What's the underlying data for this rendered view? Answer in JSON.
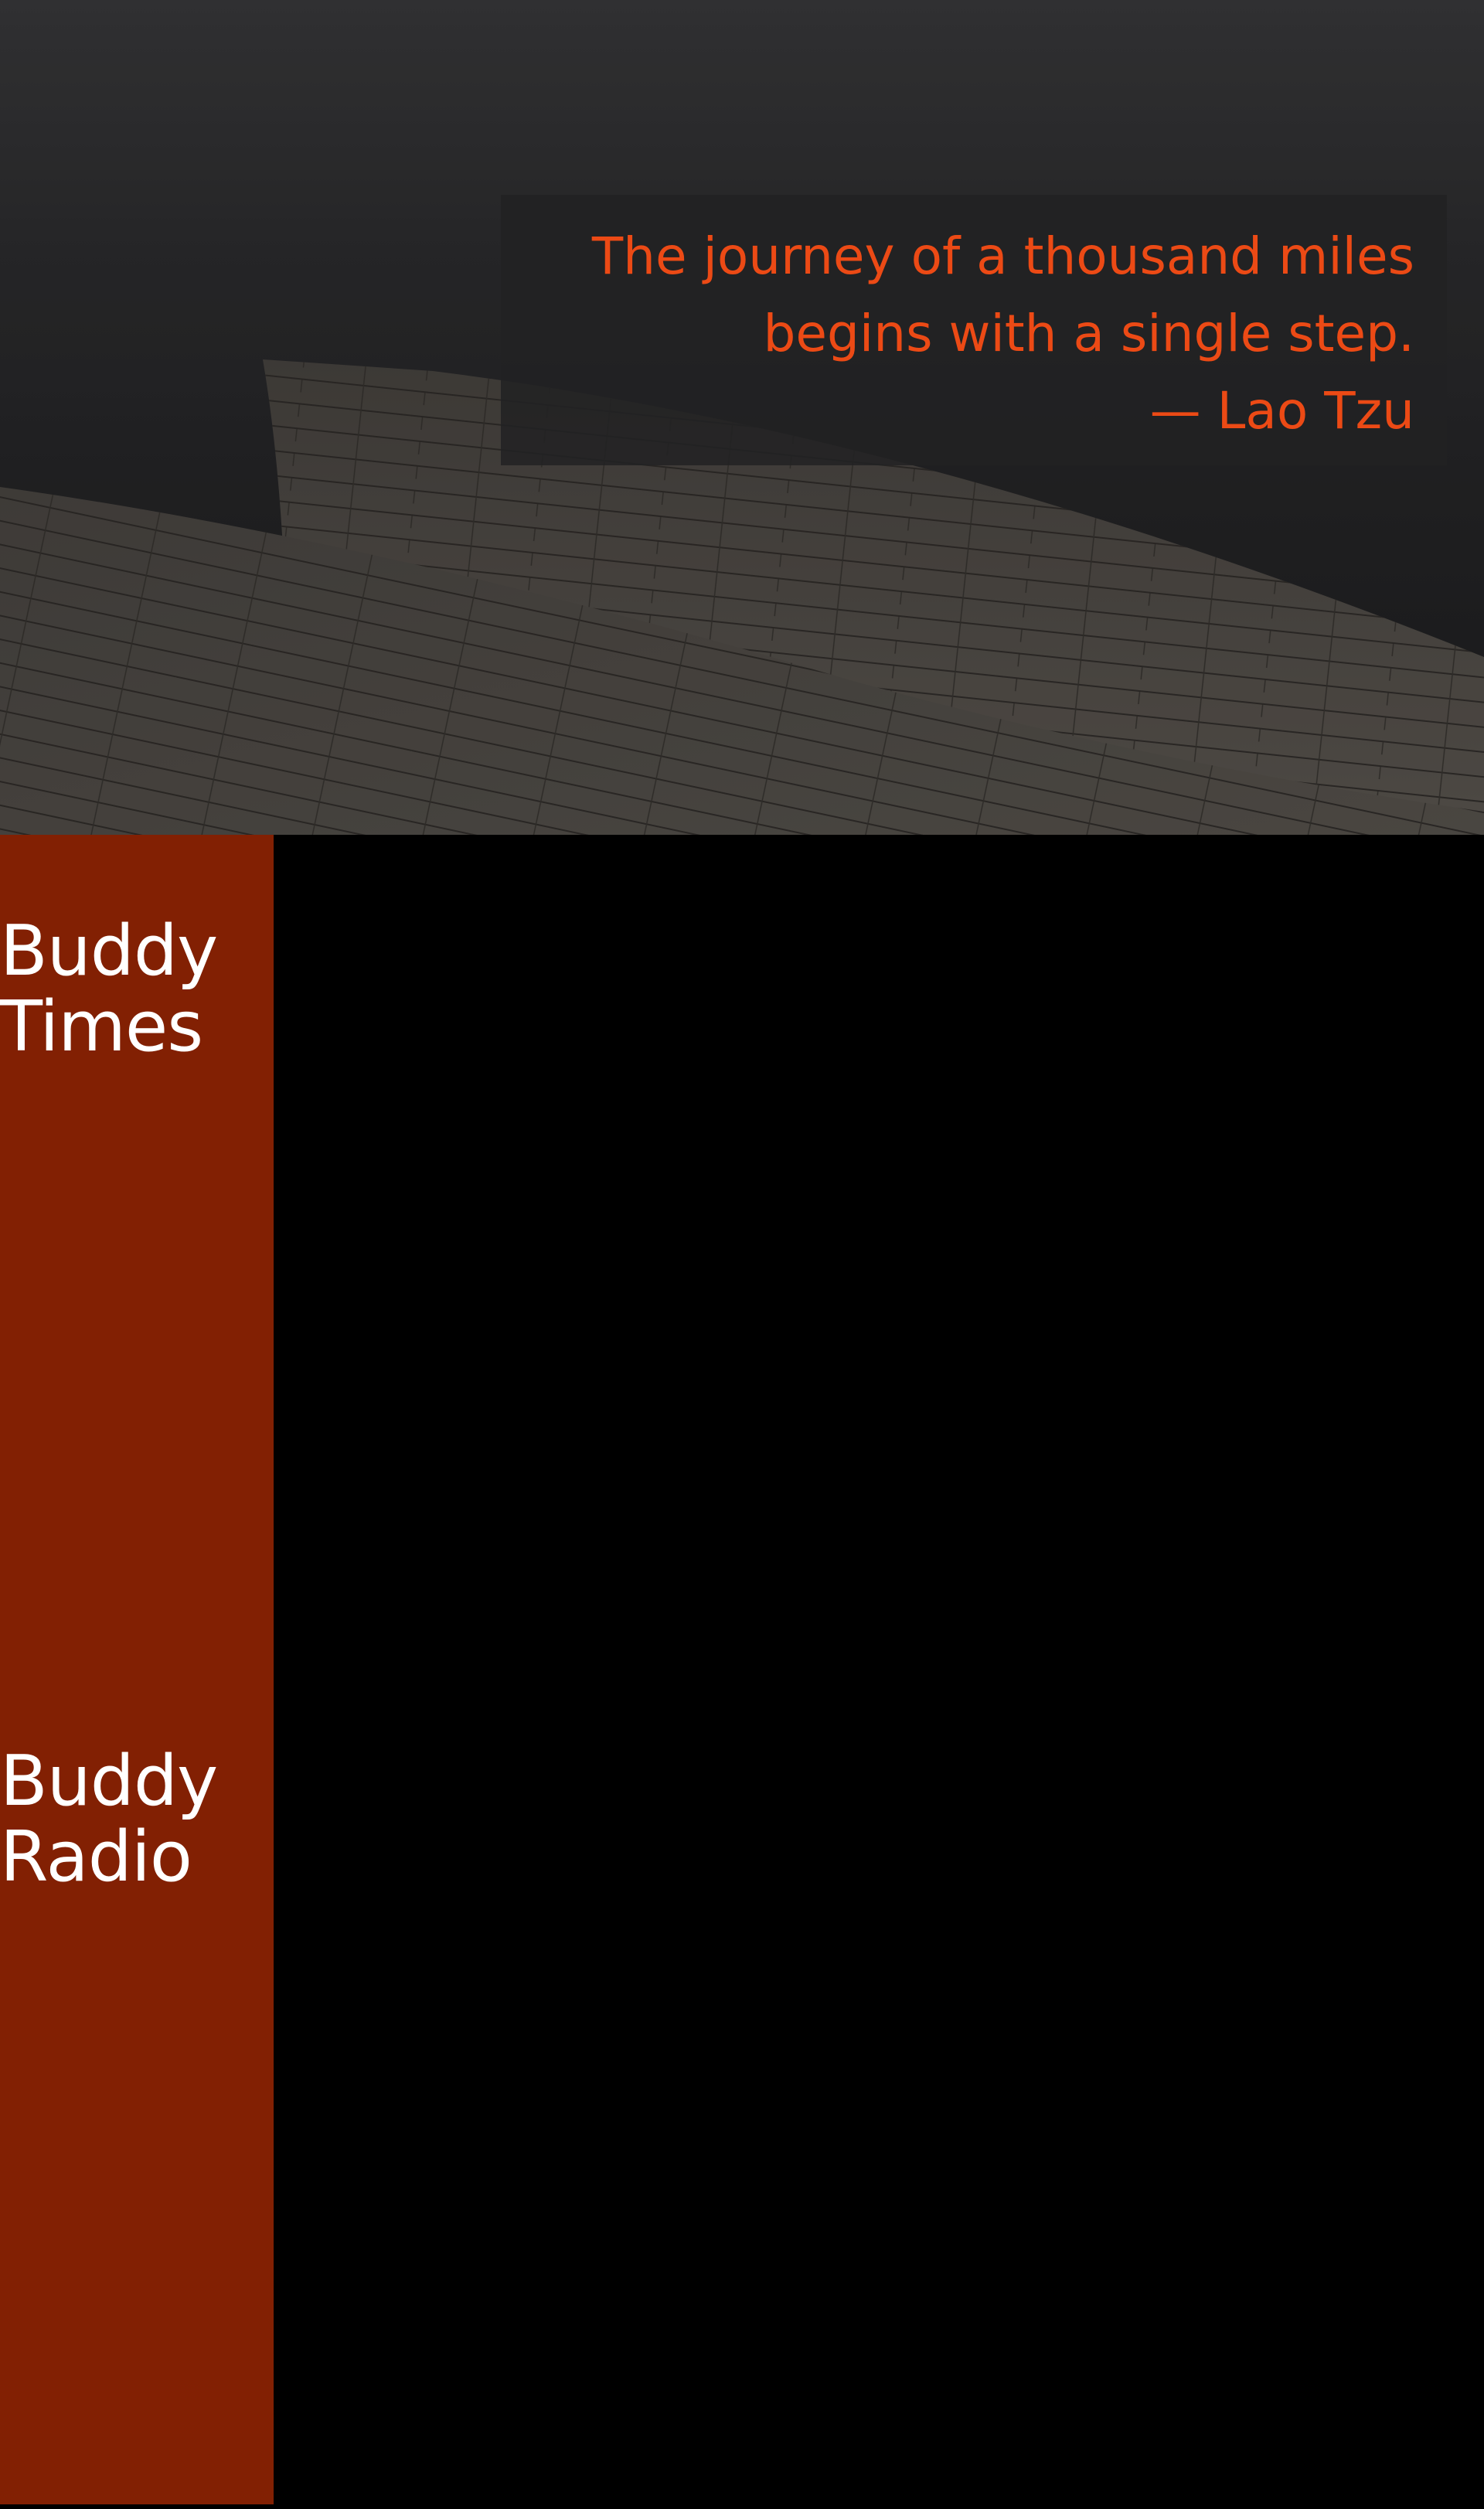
{
  "hero": {
    "quote_lines": [
      "The journey of a thousand miles",
      "begins with a single step.",
      "— Lao Tzu"
    ]
  },
  "sidebar": {
    "items": [
      {
        "lines": [
          "Buddy",
          "Times"
        ]
      },
      {
        "lines": [
          "Buddy",
          "Radio"
        ]
      }
    ]
  },
  "colors": {
    "accent": "#ec4a15",
    "sidebar_bg": "#822003",
    "main_bg": "#000000",
    "quote_box_bg": "#222223"
  }
}
